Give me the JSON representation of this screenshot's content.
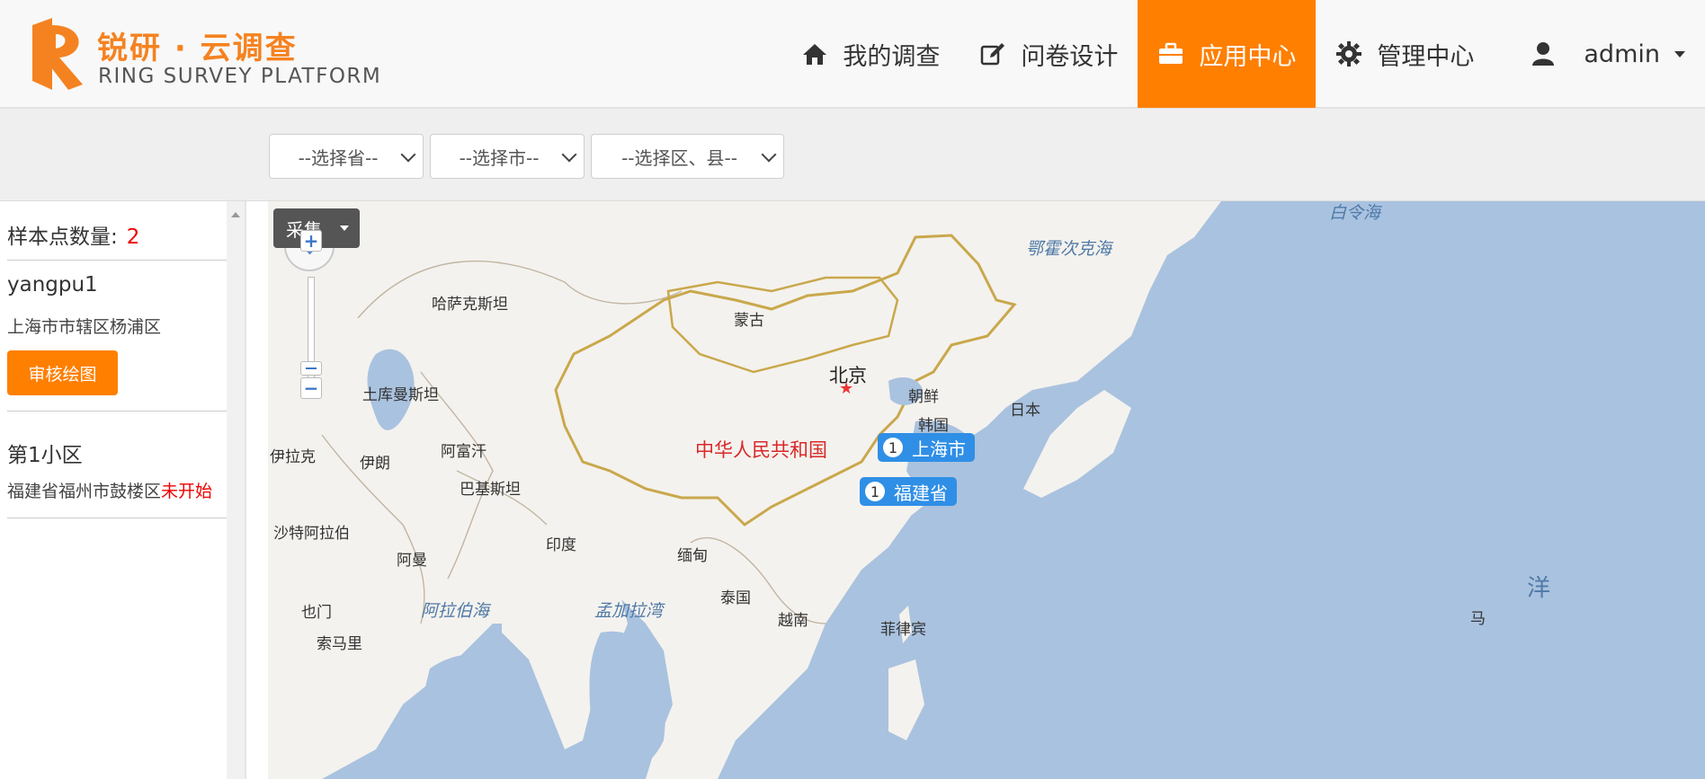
{
  "header": {
    "logo_cn": "锐研 · 云调查",
    "logo_en": "RING SURVEY PLATFORM",
    "brand_color": "#ff7f00",
    "nav": [
      {
        "label": "我的调查",
        "icon": "home-icon",
        "active": false
      },
      {
        "label": "问卷设计",
        "icon": "edit-icon",
        "active": false
      },
      {
        "label": "应用中心",
        "icon": "briefcase-icon",
        "active": true
      },
      {
        "label": "管理中心",
        "icon": "gear-icon",
        "active": false
      },
      {
        "label": "admin",
        "icon": "user-icon",
        "active": false
      }
    ]
  },
  "filters": {
    "province": "--选择省--",
    "city": "--选择市--",
    "district": "--选择区、县--"
  },
  "sidebar": {
    "count_label": "样本点数量:",
    "count_value": "2",
    "items": [
      {
        "name": "yangpu1",
        "address": "上海市市辖区杨浦区",
        "status": "",
        "button": "审核绘图"
      },
      {
        "name": "第1小区",
        "address": "福建省福州市鼓楼区",
        "status": "未开始"
      }
    ]
  },
  "map": {
    "collect_label": "采集",
    "zoom_in": "+",
    "zoom_out": "−",
    "labels": {
      "beringsea": "白令海",
      "okhotsk": "鄂霍次克海",
      "kazakhstan": "哈萨克斯坦",
      "mongolia": "蒙古",
      "beijing": "北京",
      "northkorea": "朝鲜",
      "southkorea": "韩国",
      "japan": "日本",
      "turkmenistan": "土库曼斯坦",
      "china": "中华人民共和国",
      "iraq": "伊拉克",
      "iran": "伊朗",
      "afghanistan": "阿富汗",
      "pakistan": "巴基斯坦",
      "saudi": "沙特阿拉伯",
      "oman": "阿曼",
      "india": "印度",
      "myanmar": "缅甸",
      "yemen": "也门",
      "arabiansea": "阿拉伯海",
      "bengal": "孟加拉湾",
      "thailand": "泰国",
      "vietnam": "越南",
      "philippines": "菲律宾",
      "somalia": "索马里",
      "ocean": "洋",
      "ma": "马"
    },
    "markers": [
      {
        "count": "1",
        "label": "上海市"
      },
      {
        "count": "1",
        "label": "福建省"
      }
    ]
  }
}
